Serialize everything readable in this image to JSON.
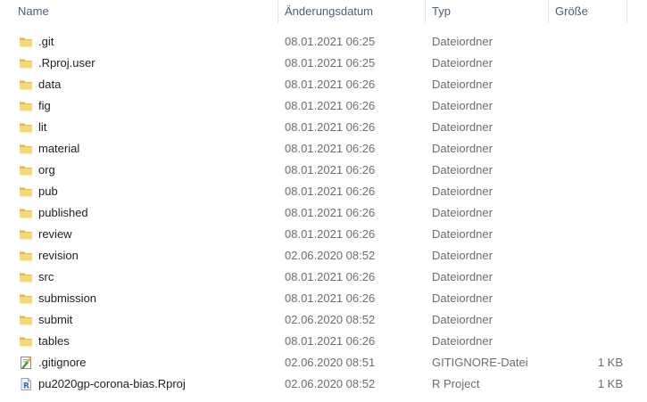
{
  "columns": {
    "name": "Name",
    "date": "Änderungsdatum",
    "type": "Typ",
    "size": "Größe"
  },
  "files": [
    {
      "name": ".git",
      "date": "08.01.2021 06:25",
      "type": "Dateiordner",
      "size": "",
      "icon": "folder-icon"
    },
    {
      "name": ".Rproj.user",
      "date": "08.01.2021 06:25",
      "type": "Dateiordner",
      "size": "",
      "icon": "folder-icon"
    },
    {
      "name": "data",
      "date": "08.01.2021 06:26",
      "type": "Dateiordner",
      "size": "",
      "icon": "folder-icon"
    },
    {
      "name": "fig",
      "date": "08.01.2021 06:26",
      "type": "Dateiordner",
      "size": "",
      "icon": "folder-icon"
    },
    {
      "name": "lit",
      "date": "08.01.2021 06:26",
      "type": "Dateiordner",
      "size": "",
      "icon": "folder-icon"
    },
    {
      "name": "material",
      "date": "08.01.2021 06:26",
      "type": "Dateiordner",
      "size": "",
      "icon": "folder-icon"
    },
    {
      "name": "org",
      "date": "08.01.2021 06:26",
      "type": "Dateiordner",
      "size": "",
      "icon": "folder-icon"
    },
    {
      "name": "pub",
      "date": "08.01.2021 06:26",
      "type": "Dateiordner",
      "size": "",
      "icon": "folder-icon"
    },
    {
      "name": "published",
      "date": "08.01.2021 06:26",
      "type": "Dateiordner",
      "size": "",
      "icon": "folder-icon"
    },
    {
      "name": "review",
      "date": "08.01.2021 06:26",
      "type": "Dateiordner",
      "size": "",
      "icon": "folder-icon"
    },
    {
      "name": "revision",
      "date": "02.06.2020 08:52",
      "type": "Dateiordner",
      "size": "",
      "icon": "folder-icon"
    },
    {
      "name": "src",
      "date": "08.01.2021 06:26",
      "type": "Dateiordner",
      "size": "",
      "icon": "folder-icon"
    },
    {
      "name": "submission",
      "date": "08.01.2021 06:26",
      "type": "Dateiordner",
      "size": "",
      "icon": "folder-icon"
    },
    {
      "name": "submit",
      "date": "02.06.2020 08:52",
      "type": "Dateiordner",
      "size": "",
      "icon": "folder-icon"
    },
    {
      "name": "tables",
      "date": "08.01.2021 06:26",
      "type": "Dateiordner",
      "size": "",
      "icon": "folder-icon"
    },
    {
      "name": ".gitignore",
      "date": "02.06.2020 08:51",
      "type": "GITIGNORE-Datei",
      "size": "1 KB",
      "icon": "text-file-icon"
    },
    {
      "name": "pu2020gp-corona-bias.Rproj",
      "date": "02.06.2020 08:52",
      "type": "R Project",
      "size": "1 KB",
      "icon": "rproject-icon"
    }
  ]
}
